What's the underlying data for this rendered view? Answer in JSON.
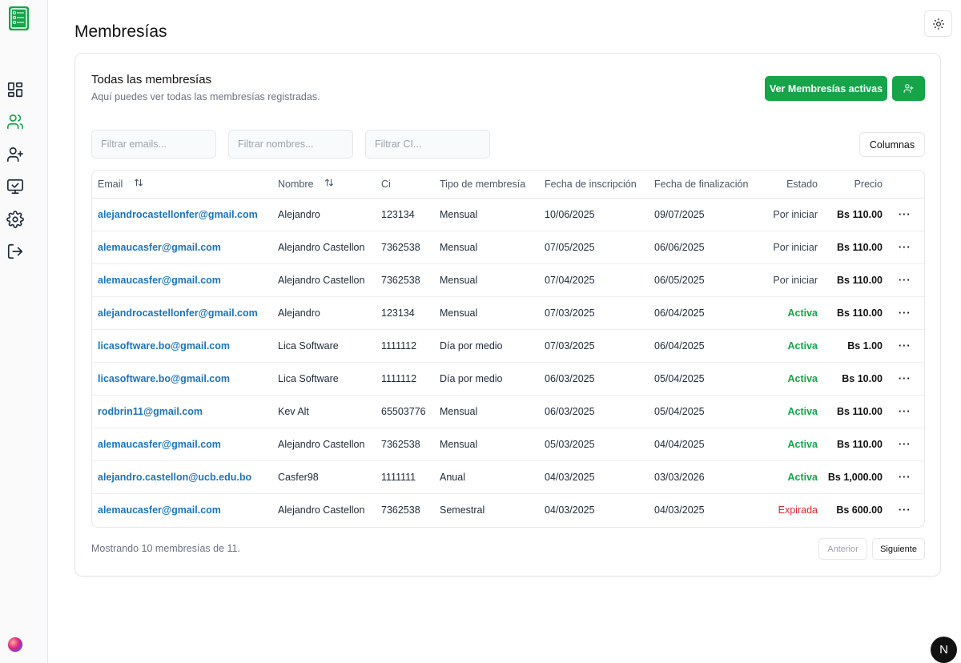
{
  "page": {
    "title": "Membresías"
  },
  "sidebar": {
    "items": [
      {
        "name": "dashboard",
        "icon": "dashboard-grid-icon"
      },
      {
        "name": "members",
        "icon": "users-icon"
      },
      {
        "name": "add-member",
        "icon": "user-plus-icon"
      },
      {
        "name": "monitor",
        "icon": "monitor-check-icon"
      },
      {
        "name": "settings",
        "icon": "gear-icon"
      },
      {
        "name": "logout",
        "icon": "logout-icon"
      }
    ]
  },
  "card": {
    "title": "Todas las membresías",
    "subtitle": "Aquí puedes ver todas las membresías registradas.",
    "btn_active": "Ver Membresías activas",
    "btn_columns": "Columnas"
  },
  "filters": {
    "email_placeholder": "Filtrar emails...",
    "name_placeholder": "Filtrar nombres...",
    "ci_placeholder": "Filtrar CI..."
  },
  "table": {
    "headers": {
      "email": "Email",
      "nombre": "Nombre",
      "ci": "Ci",
      "tipo": "Tipo de membresía",
      "inscripcion": "Fecha de inscripción",
      "finalizacion": "Fecha de finalización",
      "estado": "Estado",
      "precio": "Precio"
    },
    "rows": [
      {
        "email": "alejandrocastellonfer@gmail.com",
        "nombre": "Alejandro",
        "ci": "123134",
        "tipo": "Mensual",
        "inscripcion": "10/06/2025",
        "finalizacion": "09/07/2025",
        "estado": "Por iniciar",
        "precio": "Bs 110.00",
        "more": "···"
      },
      {
        "email": "alemaucasfer@gmail.com",
        "nombre": "Alejandro Castellon",
        "ci": "7362538",
        "tipo": "Mensual",
        "inscripcion": "07/05/2025",
        "finalizacion": "06/06/2025",
        "estado": "Por iniciar",
        "precio": "Bs 110.00",
        "more": "···"
      },
      {
        "email": "alemaucasfer@gmail.com",
        "nombre": "Alejandro Castellon",
        "ci": "7362538",
        "tipo": "Mensual",
        "inscripcion": "07/04/2025",
        "finalizacion": "06/05/2025",
        "estado": "Por iniciar",
        "precio": "Bs 110.00",
        "more": "···"
      },
      {
        "email": "alejandrocastellonfer@gmail.com",
        "nombre": "Alejandro",
        "ci": "123134",
        "tipo": "Mensual",
        "inscripcion": "07/03/2025",
        "finalizacion": "06/04/2025",
        "estado": "Activa",
        "precio": "Bs 110.00",
        "more": "···"
      },
      {
        "email": "licasoftware.bo@gmail.com",
        "nombre": "Lica Software",
        "ci": "1111112",
        "tipo": "Día por medio",
        "inscripcion": "07/03/2025",
        "finalizacion": "06/04/2025",
        "estado": "Activa",
        "precio": "Bs 1.00",
        "more": "···"
      },
      {
        "email": "licasoftware.bo@gmail.com",
        "nombre": "Lica Software",
        "ci": "1111112",
        "tipo": "Día por medio",
        "inscripcion": "06/03/2025",
        "finalizacion": "05/04/2025",
        "estado": "Activa",
        "precio": "Bs 10.00",
        "more": "···"
      },
      {
        "email": "rodbrin11@gmail.com",
        "nombre": "Kev Alt",
        "ci": "65503776",
        "tipo": "Mensual",
        "inscripcion": "06/03/2025",
        "finalizacion": "05/04/2025",
        "estado": "Activa",
        "precio": "Bs 110.00",
        "more": "···"
      },
      {
        "email": "alemaucasfer@gmail.com",
        "nombre": "Alejandro Castellon",
        "ci": "7362538",
        "tipo": "Mensual",
        "inscripcion": "05/03/2025",
        "finalizacion": "04/04/2025",
        "estado": "Activa",
        "precio": "Bs 110.00",
        "more": "···"
      },
      {
        "email": "alejandro.castellon@ucb.edu.bo",
        "nombre": "Casfer98",
        "ci": "1111111",
        "tipo": "Anual",
        "inscripcion": "04/03/2025",
        "finalizacion": "03/03/2026",
        "estado": "Activa",
        "precio": "Bs 1,000.00",
        "more": "···"
      },
      {
        "email": "alemaucasfer@gmail.com",
        "nombre": "Alejandro Castellon",
        "ci": "7362538",
        "tipo": "Semestral",
        "inscripcion": "04/03/2025",
        "finalizacion": "04/03/2025",
        "estado": "Expirada",
        "precio": "Bs 600.00",
        "more": "···"
      }
    ]
  },
  "footer": {
    "showing": "Mostrando 10 membresías de 11.",
    "prev": "Anterior",
    "next": "Siguiente"
  },
  "badge": {
    "label": "N"
  },
  "colors": {
    "brand_green": "#16a34a",
    "link_blue": "#1d74b8",
    "expired_red": "#dc2626"
  }
}
